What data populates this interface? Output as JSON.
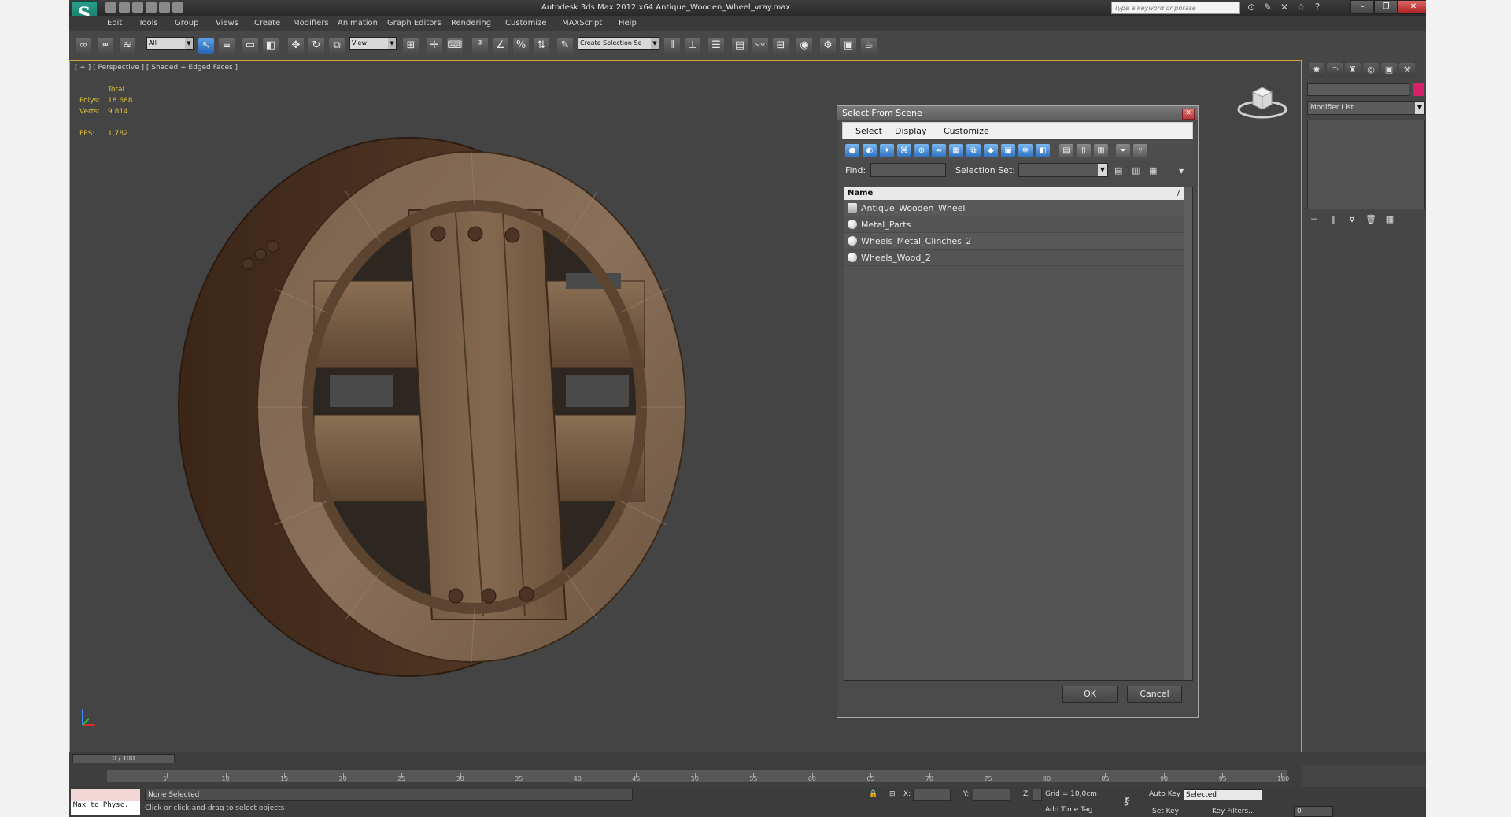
{
  "window": {
    "title": "Autodesk 3ds Max  2012 x64      Antique_Wooden_Wheel_vray.max",
    "search_placeholder": "Type a keyword or phrase"
  },
  "menu": [
    "Edit",
    "Tools",
    "Group",
    "Views",
    "Create",
    "Modifiers",
    "Animation",
    "Graph Editors",
    "Rendering",
    "Customize",
    "MAXScript",
    "Help"
  ],
  "toolbar": {
    "filter_value": "All",
    "ref_coord_value": "View",
    "selection_set_value": "Create Selection Se"
  },
  "viewport": {
    "label": "[ + ] [ Perspective ] [ Shaded + Edged Faces ]",
    "stats": {
      "total_label": "Total",
      "polys_label": "Polys:",
      "polys_value": "18 688",
      "verts_label": "Verts:",
      "verts_value": "9 814",
      "fps_label": "FPS:",
      "fps_value": "1,782"
    }
  },
  "dialog": {
    "title": "Select From Scene",
    "menu": [
      "Select",
      "Display",
      "Customize"
    ],
    "find_label": "Find:",
    "selection_set_label": "Selection Set:",
    "column_name": "Name",
    "column_sort": "/",
    "items": [
      "Antique_Wooden_Wheel",
      "Metal_Parts",
      "Wheels_Metal_Clinches_2",
      "Wheels_Wood_2"
    ],
    "ok_label": "OK",
    "cancel_label": "Cancel"
  },
  "command_panel": {
    "modifier_list": "Modifier List",
    "object_color": "#d6206a"
  },
  "timeline": {
    "slider": "0 / 100",
    "ticks": [
      "5",
      "10",
      "15",
      "20",
      "25",
      "30",
      "35",
      "40",
      "45",
      "50",
      "55",
      "60",
      "65",
      "70",
      "75",
      "80",
      "85",
      "90",
      "95",
      "100"
    ]
  },
  "status": {
    "maxscript": "Max to Physc.",
    "selection": "None Selected",
    "prompt": "Click or click-and-drag to select objects",
    "x_label": "X:",
    "y_label": "Y:",
    "z_label": "Z:",
    "grid": "Grid = 10,0cm",
    "add_time_tag": "Add Time Tag",
    "auto_key": "Auto Key",
    "set_key": "Set Key",
    "selected": "Selected",
    "key_filters": "Key Filters...",
    "frame": "0"
  },
  "colors": {
    "viewport_border": "#d1a33a",
    "stats_text": "#e0c23a",
    "app_bg": "#444444",
    "dialog_button_accent": "#2c70c0"
  }
}
